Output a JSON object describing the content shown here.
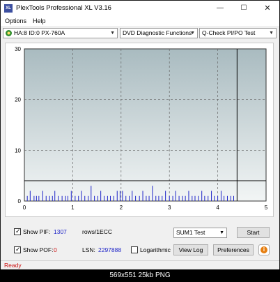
{
  "window": {
    "title": "PlexTools Professional XL V3.16",
    "app_icon": "XL"
  },
  "titlebar_buttons": {
    "minimize": "—",
    "maximize": "☐",
    "close": "✕"
  },
  "menu": {
    "items": [
      "Options",
      "Help"
    ]
  },
  "toolbar": {
    "drive": "HA:8 ID:0  PX-760A",
    "function": "DVD Diagnostic Functions",
    "test": "Q-Check PI/PO Test",
    "dropdown_arrow": "▼"
  },
  "chart_data": {
    "type": "bar",
    "x_ticks": [
      "0",
      "1",
      "2",
      "3",
      "4",
      "5"
    ],
    "y_ticks": [
      "0",
      "10",
      "20",
      "30"
    ],
    "xlim": [
      0,
      5
    ],
    "ylim": [
      0,
      30
    ],
    "grid": true,
    "threshold_line": 4,
    "end_marker_x": 4.4,
    "background": "gradient gray-blue",
    "series": [
      {
        "color": "#1f25c8",
        "x": [
          0.06,
          0.12,
          0.2,
          0.25,
          0.3,
          0.38,
          0.45,
          0.52,
          0.58,
          0.63,
          0.7,
          0.78,
          0.85,
          0.9,
          0.97,
          1.05,
          1.12,
          1.18,
          1.25,
          1.32,
          1.38,
          1.45,
          1.52,
          1.58,
          1.65,
          1.72,
          1.78,
          1.85,
          1.92,
          1.98,
          2.03,
          2.1,
          2.17,
          2.23,
          2.3,
          2.38,
          2.45,
          2.52,
          2.58,
          2.65,
          2.72,
          2.78,
          2.85,
          2.92,
          3.0,
          3.07,
          3.13,
          3.2,
          3.27,
          3.33,
          3.4,
          3.47,
          3.53,
          3.6,
          3.67,
          3.73,
          3.8,
          3.87,
          3.93,
          4.0,
          4.07,
          4.13,
          4.2,
          4.27,
          4.33
        ],
        "values": [
          1,
          2,
          1,
          1,
          1,
          2,
          1,
          1,
          1,
          2,
          1,
          1,
          1,
          1,
          2,
          1,
          1,
          2,
          1,
          1,
          3,
          1,
          1,
          2,
          1,
          1,
          1,
          1,
          2,
          2,
          2,
          1,
          1,
          2,
          1,
          1,
          2,
          1,
          1,
          3,
          1,
          1,
          1,
          2,
          1,
          1,
          2,
          1,
          1,
          1,
          2,
          1,
          1,
          1,
          2,
          1,
          1,
          2,
          1,
          1,
          2,
          1,
          1,
          1,
          1
        ]
      }
    ]
  },
  "bottom": {
    "show_pif_label": "Show PIF:",
    "pif_value": "1307",
    "pif_unit": "rows/1ECC",
    "show_pof_label": "Show POF:",
    "pof_value": "0",
    "lsn_label": "LSN:",
    "lsn_value": "2297888",
    "logarithmic_label": "Logarithmic",
    "sum_select": "SUM1 Test",
    "start_button": "Start",
    "view_log_button": "View Log",
    "preferences_button": "Preferences",
    "info_icon": "i",
    "checkmark": "✓",
    "show_pif_checked": true,
    "show_pof_checked": true,
    "logarithmic_checked": false
  },
  "status": {
    "text": "Ready"
  },
  "caption": {
    "text": "569x551  25kb  PNG"
  }
}
